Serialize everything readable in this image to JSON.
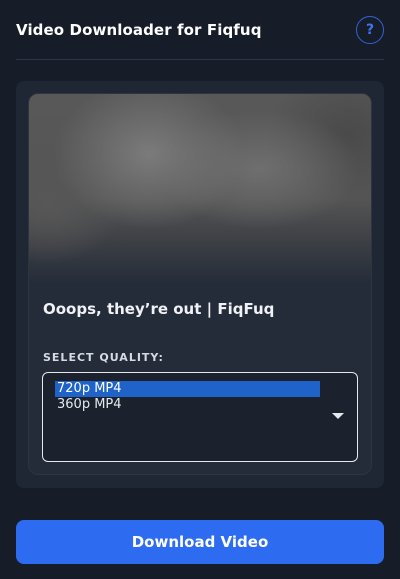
{
  "header": {
    "title": "Video Downloader for Fiqfuq",
    "help_label": "?"
  },
  "video": {
    "title": "Ooops, they’re out | FiqFuq"
  },
  "quality": {
    "label": "SELECT QUALITY:",
    "options": [
      "720p MP4",
      "360p MP4"
    ],
    "selected": "720p MP4"
  },
  "actions": {
    "download_label": "Download Video"
  },
  "icons": {
    "help": "question-mark-icon",
    "dropdown": "chevron-down-icon"
  },
  "colors": {
    "background": "#161d29",
    "accent": "#2d6cf0",
    "selection": "#1f63c9"
  }
}
